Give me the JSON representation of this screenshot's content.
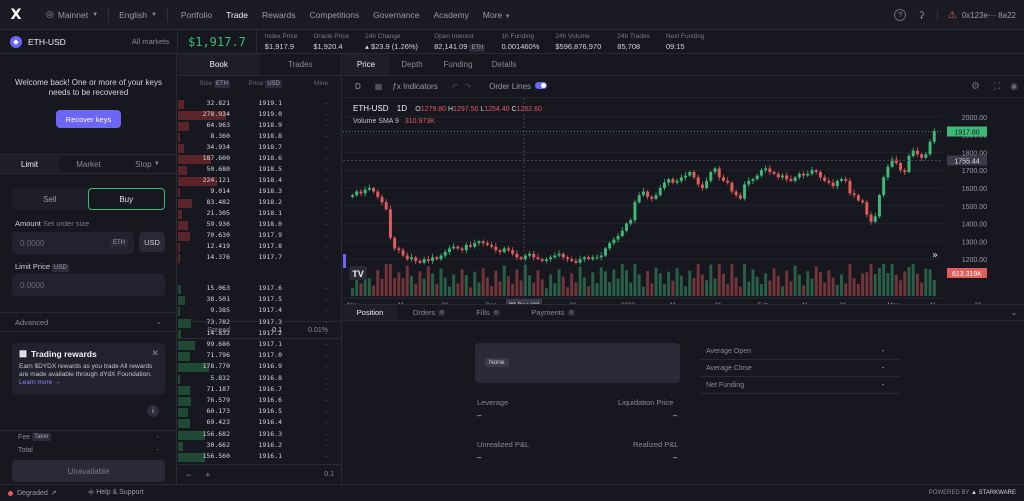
{
  "nav": {
    "logo": "X",
    "network": "Mainnet",
    "language": "English",
    "links": [
      "Portfolio",
      "Trade",
      "Rewards",
      "Competitions",
      "Governance",
      "Academy"
    ],
    "more": "More",
    "wallet": "0x123e··· 8a22"
  },
  "market": {
    "name": "ETH-USD",
    "all_markets": "All markets",
    "price": "$1,917.7",
    "stats": [
      {
        "label": "Index Price",
        "value": "$1,917.9"
      },
      {
        "label": "Oracle Price",
        "value": "$1,920.4"
      },
      {
        "label": "24h Change",
        "value": "▴ $23.9 (1.26%)"
      },
      {
        "label": "Open Interest",
        "value": "82,141.09",
        "tag": "ETH"
      },
      {
        "label": "1h Funding",
        "value": "0.001460%"
      },
      {
        "label": "24h Volume",
        "value": "$596,876,970"
      },
      {
        "label": "24h Trades",
        "value": "85,708"
      },
      {
        "label": "Next Funding",
        "value": "09:15"
      }
    ]
  },
  "left": {
    "welcome": "Welcome back! One or more of your keys needs to be recovered",
    "recover": "Recover keys",
    "tabs": [
      "Limit",
      "Market",
      "Stop"
    ],
    "sides": [
      "Sell",
      "Buy"
    ],
    "amount_label": "Amount",
    "amount_sub": "Set order size",
    "amount_placeholder": "0.0000",
    "amount_unit": "ETH",
    "usd_btn": "USD",
    "limit_label": "Limit Price",
    "limit_unit": "USD",
    "limit_placeholder": "0.0000",
    "advanced": "Advanced",
    "rewards_title": "Trading rewards",
    "rewards_body": "Earn $DYDX rewards as you trade All rewards are made available through dYdX Foundation.",
    "rewards_link": "Learn more →",
    "fee_label": "Fee",
    "fee_tag": "Taker",
    "fee_value": "-",
    "total_label": "Total",
    "total_value": "-",
    "unavailable": "Unavailable"
  },
  "orderbook": {
    "tabs": [
      "Book",
      "Trades"
    ],
    "headers": {
      "size": "Size",
      "size_tag": "ETH",
      "price": "Price",
      "price_tag": "USD",
      "mine": "Mine"
    },
    "asks": [
      [
        "32.821",
        "1919.1"
      ],
      [
        "278.934",
        "1919.0"
      ],
      [
        "64.963",
        "1918.9"
      ],
      [
        "8.360",
        "1918.8"
      ],
      [
        "34.934",
        "1918.7"
      ],
      [
        "187.600",
        "1918.6"
      ],
      [
        "50.680",
        "1918.5"
      ],
      [
        "224.121",
        "1918.4"
      ],
      [
        "9.014",
        "1918.3"
      ],
      [
        "83.482",
        "1918.2"
      ],
      [
        "21.305",
        "1918.1"
      ],
      [
        "59.936",
        "1918.0"
      ],
      [
        "70.630",
        "1917.9"
      ],
      [
        "12.419",
        "1917.8"
      ],
      [
        "14.376",
        "1917.7"
      ]
    ],
    "spread_label": "Spread",
    "spread_value": "0.1",
    "spread_pct": "0.01%",
    "bids": [
      [
        "15.063",
        "1917.6"
      ],
      [
        "38.501",
        "1917.5"
      ],
      [
        "9.385",
        "1917.4"
      ],
      [
        "73.782",
        "1917.3"
      ],
      [
        "14.832",
        "1917.2"
      ],
      [
        "99.686",
        "1917.1"
      ],
      [
        "71.796",
        "1917.0"
      ],
      [
        "178.770",
        "1916.9"
      ],
      [
        "5.832",
        "1916.8"
      ],
      [
        "71.187",
        "1916.7"
      ],
      [
        "76.579",
        "1916.6"
      ],
      [
        "60.173",
        "1916.5"
      ],
      [
        "69.423",
        "1916.4"
      ],
      [
        "156.682",
        "1916.3"
      ],
      [
        "30.662",
        "1916.2"
      ],
      [
        "156.560",
        "1916.1"
      ]
    ],
    "mine": "-",
    "minus": "−",
    "plus": "+",
    "group": "0.1"
  },
  "chart": {
    "tabs": [
      "Price",
      "Depth",
      "Funding",
      "Details"
    ],
    "interval": "D",
    "indicators": "Indicators",
    "order_lines": "Order Lines",
    "symbol": "ETH-USD",
    "timeframe": "1D",
    "ohlc": {
      "o_label": "O",
      "o": "1279.80",
      "h_label": "H",
      "h": "1297.50",
      "l_label": "L",
      "l": "1254.40",
      "c_label": "C",
      "c": "1262.60"
    },
    "volume_label": "Volume SMA 9",
    "volume_value": "310.973K",
    "price_labels": [
      "2000.00",
      "1900.00",
      "1800.00",
      "1700.00",
      "1600.00",
      "1500.00",
      "1400.00",
      "1300.00",
      "1200.00"
    ],
    "current_price": "1917.80",
    "crosshair_price": "1755.44",
    "volume_tag": "613.319K",
    "date_labels": [
      "Nov",
      "11",
      "21",
      "Dec",
      "09 Dec '22",
      "21",
      "2023",
      "11",
      "21",
      "Feb",
      "11",
      "21",
      "Mar",
      "11",
      "21"
    ],
    "up_color": "#3dba78",
    "down_color": "#e35c5c"
  },
  "chart_data": {
    "type": "candlestick",
    "x_start": "Nov",
    "y_range": [
      1150,
      2050
    ],
    "closes": [
      1560,
      1580,
      1570,
      1590,
      1600,
      1580,
      1550,
      1520,
      1480,
      1320,
      1260,
      1250,
      1220,
      1200,
      1210,
      1190,
      1180,
      1200,
      1190,
      1210,
      1200,
      1220,
      1240,
      1260,
      1270,
      1260,
      1250,
      1280,
      1270,
      1290,
      1300,
      1290,
      1280,
      1270,
      1250,
      1240,
      1260,
      1250,
      1230,
      1210,
      1200,
      1220,
      1230,
      1210,
      1200,
      1190,
      1200,
      1210,
      1220,
      1230,
      1210,
      1200,
      1190,
      1180,
      1200,
      1210,
      1200,
      1210,
      1210,
      1220,
      1260,
      1290,
      1310,
      1330,
      1360,
      1400,
      1420,
      1520,
      1560,
      1580,
      1550,
      1540,
      1560,
      1600,
      1630,
      1650,
      1630,
      1640,
      1660,
      1670,
      1690,
      1660,
      1620,
      1600,
      1640,
      1690,
      1710,
      1660,
      1640,
      1630,
      1580,
      1560,
      1540,
      1620,
      1640,
      1650,
      1670,
      1700,
      1710,
      1690,
      1680,
      1660,
      1670,
      1650,
      1640,
      1660,
      1680,
      1670,
      1680,
      1700,
      1690,
      1660,
      1640,
      1630,
      1610,
      1640,
      1650,
      1640,
      1570,
      1560,
      1530,
      1520,
      1450,
      1410,
      1440,
      1560,
      1660,
      1720,
      1760,
      1740,
      1700,
      1690,
      1780,
      1810,
      1790,
      1770,
      1790,
      1860,
      1920
    ],
    "volume_last": "613.319K"
  },
  "bottom": {
    "tabs": [
      {
        "label": "Position",
        "count": ""
      },
      {
        "label": "Orders",
        "count": "0"
      },
      {
        "label": "Fills",
        "count": "0"
      },
      {
        "label": "Payments",
        "count": "0"
      }
    ],
    "position_side": "None",
    "leverage_label": "Leverage",
    "leverage_value": "–",
    "liq_label": "Liquidation Price",
    "liq_value": "–",
    "upnl_label": "Unrealized P&L",
    "upnl_value": "–",
    "rpnl_label": "Realized P&L",
    "rpnl_value": "–",
    "details": [
      {
        "label": "Average Open",
        "value": "-"
      },
      {
        "label": "Average Close",
        "value": "-"
      },
      {
        "label": "Net Funding",
        "value": "-"
      }
    ]
  },
  "footer": {
    "status": "Degraded",
    "help": "Help & Support",
    "powered": "POWERED BY",
    "starkware": "STARKWARE"
  }
}
